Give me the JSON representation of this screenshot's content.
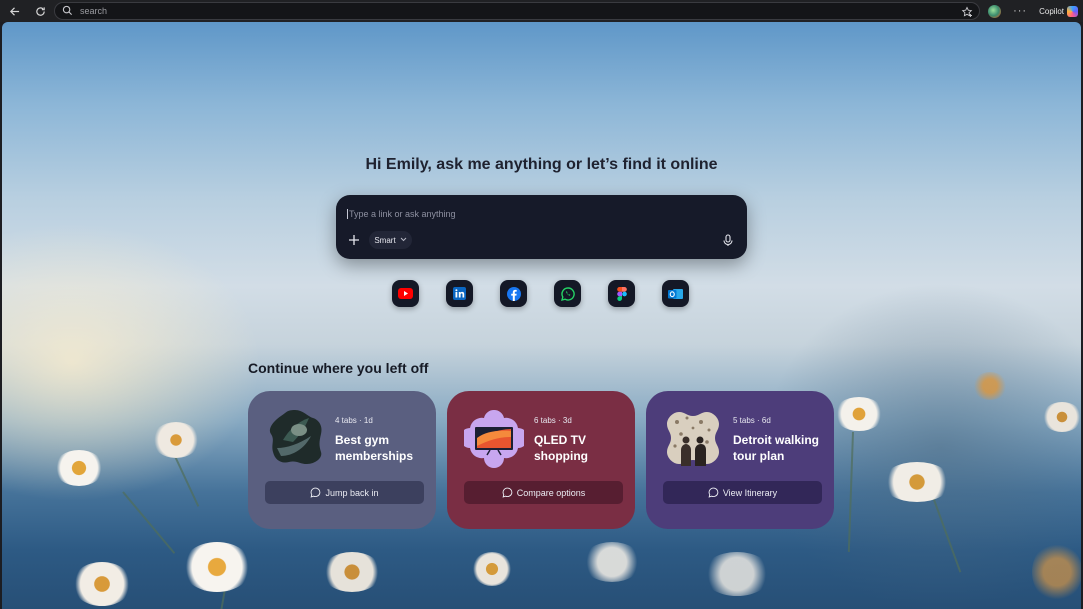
{
  "browser": {
    "search_placeholder": "search",
    "copilot_label": "Copilot",
    "more_label": "···"
  },
  "greeting": "Hi Emily, ask me anything or let’s find it online",
  "search": {
    "placeholder": "Type a link or ask anything",
    "mode_label": "Smart"
  },
  "shortcuts": [
    {
      "name": "youtube",
      "color": "#ff0000"
    },
    {
      "name": "linkedin",
      "color": "#0a66c2"
    },
    {
      "name": "facebook",
      "color": "#1877f2"
    },
    {
      "name": "whatsapp",
      "color": "#25d366"
    },
    {
      "name": "figma",
      "color": "#f24e1e"
    },
    {
      "name": "outlook",
      "color": "#0078d4"
    }
  ],
  "continue_heading": "Continue where you left off",
  "cards": [
    {
      "meta": "4 tabs · 1d",
      "title": "Best gym memberships",
      "action": "Jump back in"
    },
    {
      "meta": "6 tabs · 3d",
      "title": "QLED TV shopping",
      "action": "Compare options"
    },
    {
      "meta": "5 tabs · 6d",
      "title": "Detroit walking tour plan",
      "action": "View Itinerary"
    }
  ]
}
